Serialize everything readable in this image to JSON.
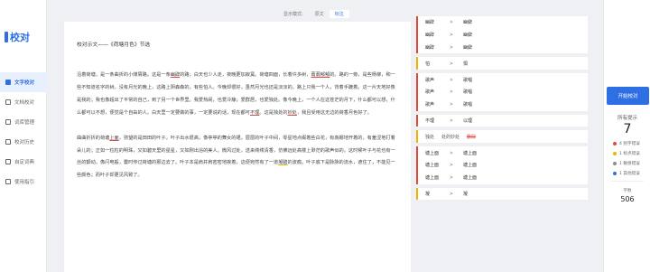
{
  "app": {
    "title": "校对"
  },
  "sidebar": {
    "items": [
      {
        "label": "文字校对",
        "active": true
      },
      {
        "label": "文档校对",
        "active": false
      },
      {
        "label": "词库管理",
        "active": false
      },
      {
        "label": "校对历史",
        "active": false
      },
      {
        "label": "自定词典",
        "active": false
      },
      {
        "label": "使用指引",
        "active": false
      }
    ]
  },
  "topbar": {
    "label": "显示模式:",
    "options": [
      "原文",
      "标注"
    ],
    "selected": "标注"
  },
  "document": {
    "title": "校对示文——《荷塘月色》节选",
    "paragraphs": [
      [
        {
          "t": "沿着荷塘，是一条曲折的小煤屑路。这是一条"
        },
        {
          "t": "幽辟",
          "mark": "red"
        },
        {
          "t": "的路；白天也少人走，夜晚更加寂寞。荷塘四面，长着许多树，"
        },
        {
          "t": "蓊蓊郁郁",
          "mark": "red"
        },
        {
          "t": "的。路的一旁，是些杨柳，和一些不知道名字的树。没有月光的晚上，这路上阴森森的，有些怕人。今晚却很好，虽然月光也还是淡淡的。路上只我一个人，背着手踱着。这一片天地好像是我的；我也像超出了平常的自己，到了另一个世界里。我爱热闹，也爱冷静；爱群居，也爱独处。像今晚上，一个人在这苍茫的月下，什么都可以想，什么都可以不想，便觉是个自由的人。白天里一定要做的事，一定要说的话，现在都可"
        },
        {
          "t": "不理",
          "mark": "red"
        },
        {
          "t": "。这是独处的"
        },
        {
          "t": "妙处",
          "mark": "red"
        },
        {
          "t": "，我且受用这无边的荷香月色好了。"
        }
      ],
      [
        {
          "t": "曲曲折折的荷塘"
        },
        {
          "t": "上面",
          "mark": "red"
        },
        {
          "t": "，弥望的是田田的叶子。叶子出水很高，像亭亭的舞女的裙。层层的叶子中间，零星地点缀着些白花，有袅娜地开着的，有羞涩地打着朵儿的；正如一粒粒的明珠，又如碧天里的星星，又如刚出浴的美人。微风过处，送来缕缕清香，仿佛远处高楼上渺茫的歌声似的。这时候叶子与花也有一丝的颤动，像闪电般，霎时传过荷塘的那边去了。叶子本是肩并肩密密地挨着，这便宛然有了一道"
        },
        {
          "t": "凝碧",
          "mark": "yellow"
        },
        {
          "t": "的波痕。叶子底下是脉脉的流水，遮住了，不能见一些颜色；而叶子却更见风致了。"
        }
      ]
    ]
  },
  "suggestions": {
    "groups": [
      {
        "color": "red",
        "rows": [
          {
            "from": "幽辟",
            "to": "幽僻"
          },
          {
            "from": "幽辟",
            "to": "幽僻"
          },
          {
            "from": "幽辟",
            "to": "幽僻"
          }
        ]
      },
      {
        "color": "yellow",
        "rows": [
          {
            "from": "怕",
            "to": "惧"
          }
        ]
      },
      {
        "color": "red",
        "rows": [
          {
            "from": "歌声",
            "to": "歌唱"
          },
          {
            "from": "歌声",
            "to": "歌唱"
          },
          {
            "from": "歌声",
            "to": "歌唱"
          }
        ]
      },
      {
        "color": "red",
        "rows": [
          {
            "from": "不理",
            "to": "以理"
          }
        ]
      },
      {
        "color": "yellow",
        "rows": [
          {
            "type": "delete",
            "orig": "独处",
            "original": "处的妙处",
            "deleted": "删除"
          }
        ]
      },
      {
        "color": "red",
        "rows": [
          {
            "from": "塘上面",
            "to": "塘上面"
          },
          {
            "from": "塘上面",
            "to": "塘上面"
          },
          {
            "from": "塘上面",
            "to": "塘上面"
          }
        ]
      },
      {
        "color": "yellow",
        "rows": [
          {
            "from": "凝",
            "to": "凝"
          }
        ]
      }
    ]
  },
  "summary": {
    "start_button": "开始校对",
    "result_label": "所有提示",
    "result_count": "7",
    "stats": [
      {
        "label": "4 别字错误",
        "color": "#e04a3c"
      },
      {
        "label": "1 标点错误",
        "color": "#f0b400"
      },
      {
        "label": "1 敏感错误",
        "color": "#8c8c8c"
      },
      {
        "label": "1 其他错误",
        "color": "#2f6fe4"
      }
    ],
    "word_count_label": "字数",
    "word_count": "506"
  }
}
